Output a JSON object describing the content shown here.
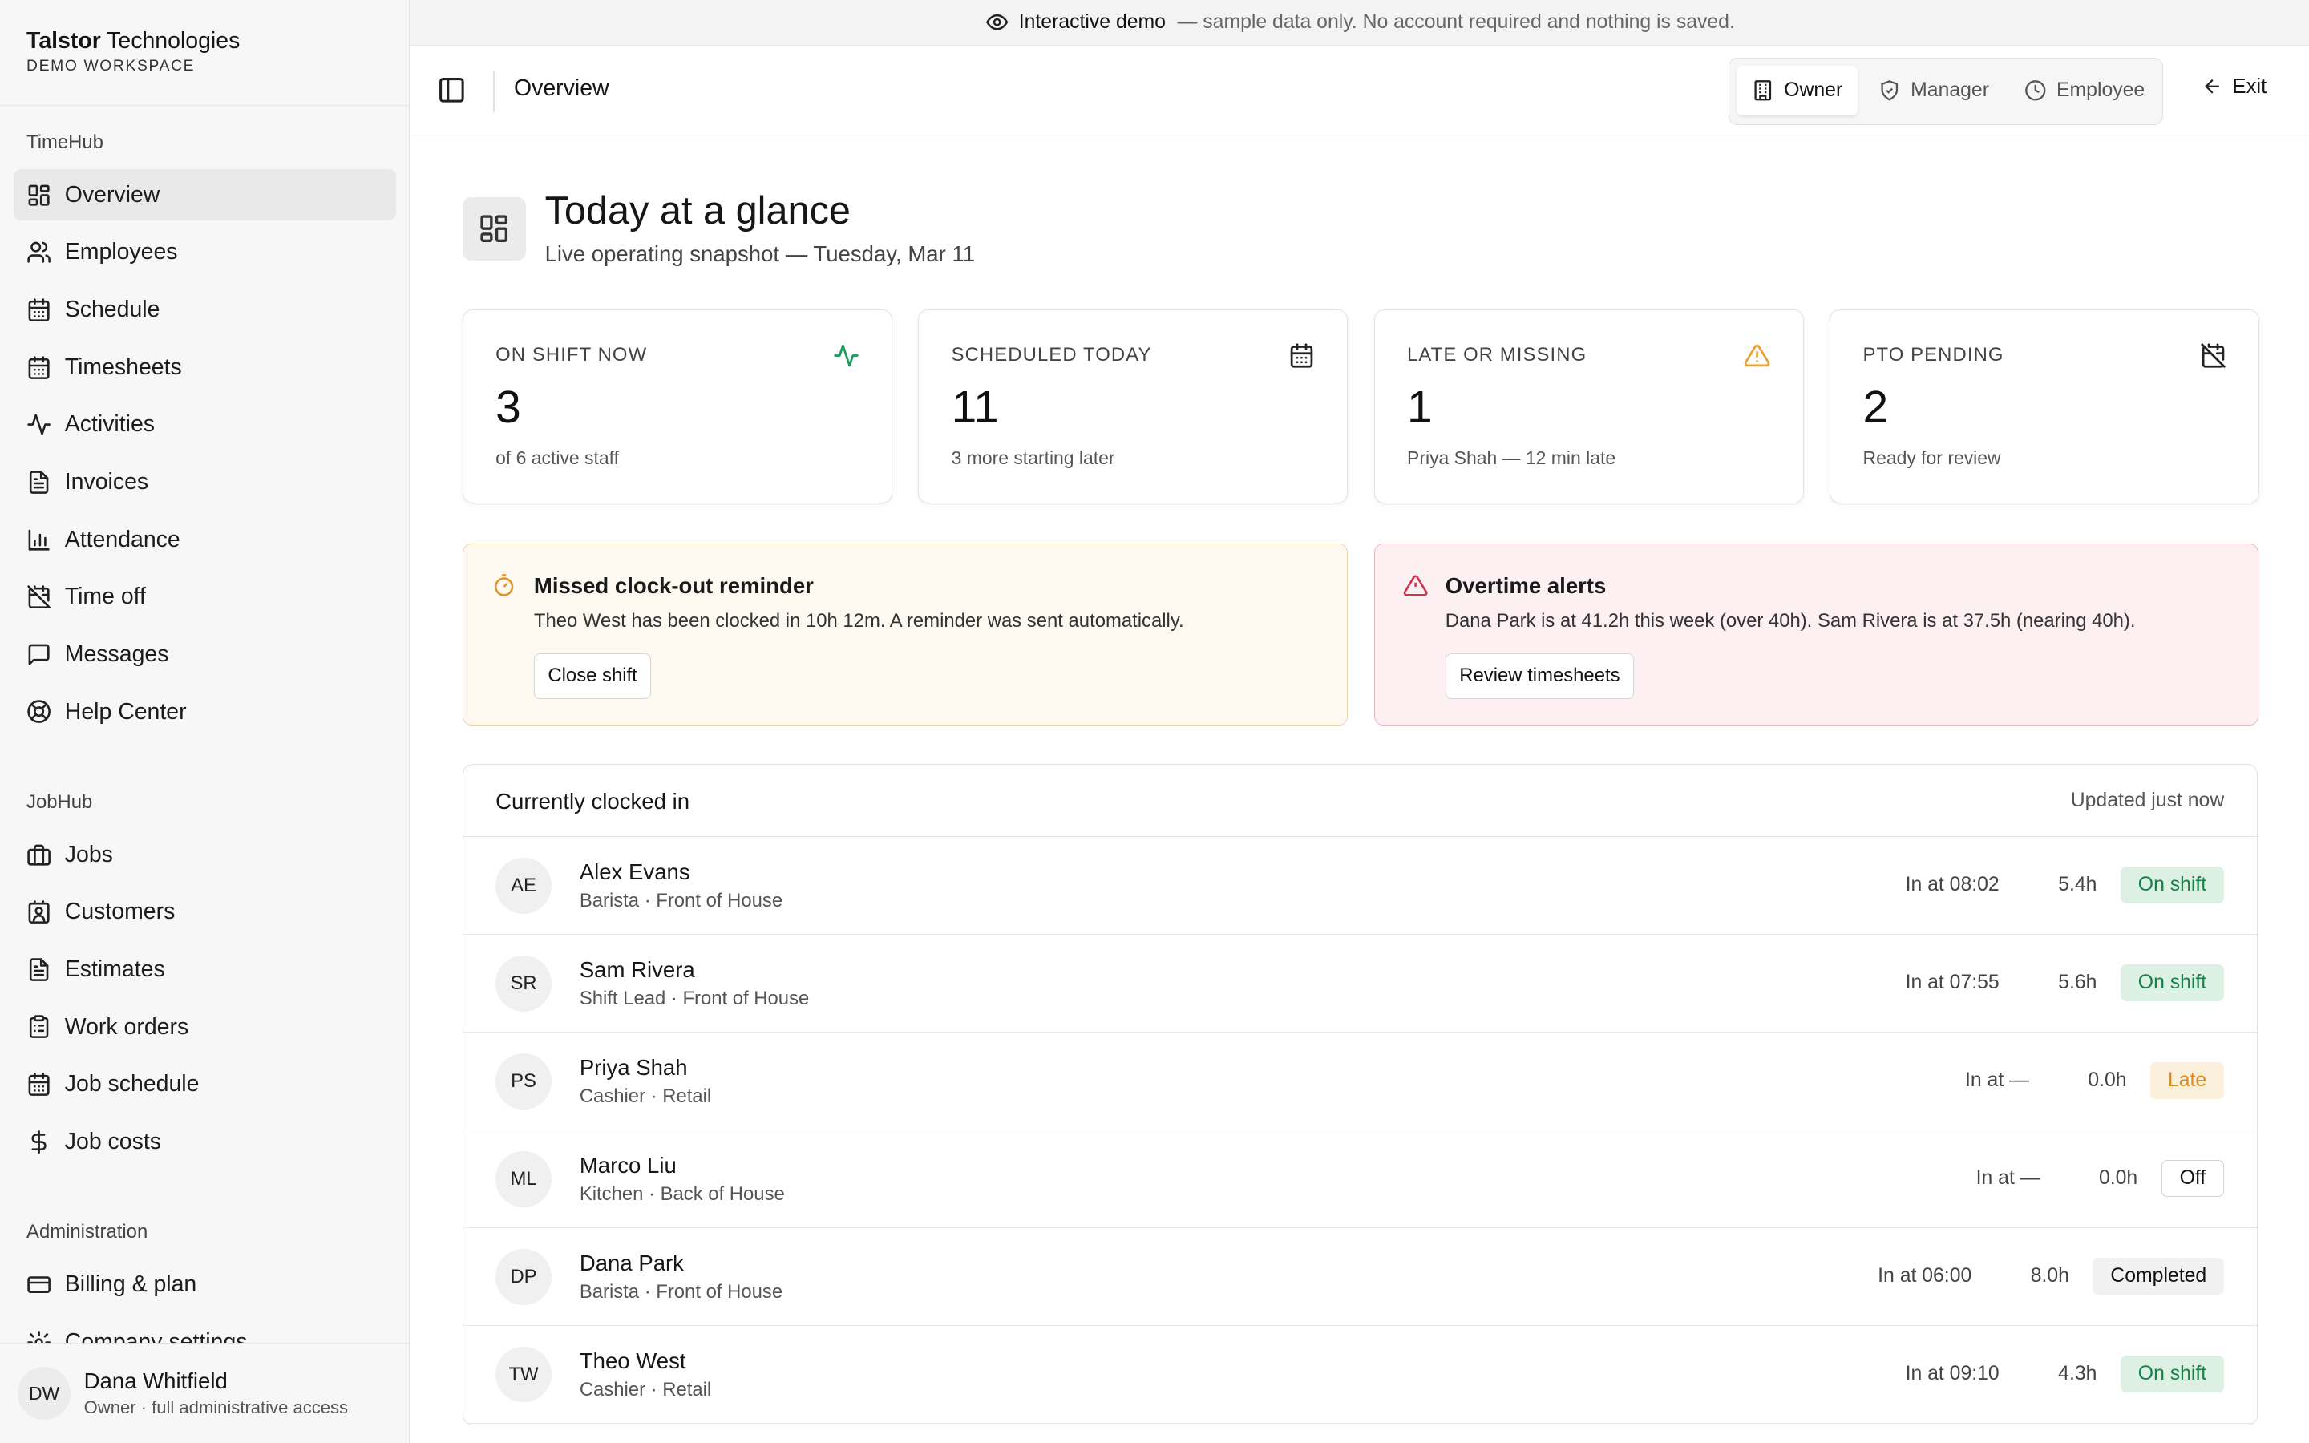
{
  "banner": {
    "label": "Interactive demo",
    "text": "— sample data only. No account required and nothing is saved."
  },
  "brand": {
    "name_bold": "Talstor",
    "name_rest": " Technologies",
    "sub": "DEMO WORKSPACE"
  },
  "sidebar": {
    "sections": [
      {
        "label": "TimeHub",
        "items": [
          {
            "label": "Overview",
            "icon": "grid-icon",
            "active": true
          },
          {
            "label": "Employees",
            "icon": "users-icon"
          },
          {
            "label": "Schedule",
            "icon": "calendar-icon"
          },
          {
            "label": "Timesheets",
            "icon": "calendar-icon"
          },
          {
            "label": "Activities",
            "icon": "activity-icon"
          },
          {
            "label": "Invoices",
            "icon": "file-icon"
          },
          {
            "label": "Attendance",
            "icon": "bar-chart-icon"
          },
          {
            "label": "Time off",
            "icon": "calendar-off-icon"
          },
          {
            "label": "Messages",
            "icon": "message-icon"
          },
          {
            "label": "Help Center",
            "icon": "life-buoy-icon"
          }
        ]
      },
      {
        "label": "JobHub",
        "items": [
          {
            "label": "Jobs",
            "icon": "briefcase-icon"
          },
          {
            "label": "Customers",
            "icon": "contact-icon"
          },
          {
            "label": "Estimates",
            "icon": "file-icon"
          },
          {
            "label": "Work orders",
            "icon": "clipboard-icon"
          },
          {
            "label": "Job schedule",
            "icon": "calendar-icon"
          },
          {
            "label": "Job costs",
            "icon": "dollar-icon"
          }
        ]
      },
      {
        "label": "Administration",
        "items": [
          {
            "label": "Billing & plan",
            "icon": "credit-card-icon"
          },
          {
            "label": "Company settings",
            "icon": "settings-icon"
          }
        ]
      }
    ]
  },
  "user": {
    "initials": "DW",
    "name": "Dana Whitfield",
    "role": "Owner · full administrative access"
  },
  "topbar": {
    "title": "Overview",
    "roles": [
      "Owner",
      "Manager",
      "Employee"
    ],
    "active_role": "Owner",
    "exit": "Exit"
  },
  "header": {
    "title": "Today at a glance",
    "subtitle": "Live operating snapshot — Tuesday, Mar 11"
  },
  "stats": [
    {
      "label": "ON SHIFT NOW",
      "value": "3",
      "sub": "of 6 active staff",
      "icon": "activity-icon",
      "color": "#1a9a5c"
    },
    {
      "label": "SCHEDULED TODAY",
      "value": "11",
      "sub": "3 more starting later",
      "icon": "calendar-icon",
      "color": "#222222"
    },
    {
      "label": "LATE OR MISSING",
      "value": "1",
      "sub": "Priya Shah — 12 min late",
      "icon": "warning-icon",
      "color": "#e6a23c"
    },
    {
      "label": "PTO PENDING",
      "value": "2",
      "sub": "Ready for review",
      "icon": "calendar-off-icon",
      "color": "#222222"
    }
  ],
  "alerts": [
    {
      "title": "Missed clock-out reminder",
      "desc": "Theo West has been clocked in 10h 12m. A reminder was sent automatically.",
      "button": "Close shift",
      "color": "#e0962c"
    },
    {
      "title": "Overtime alerts",
      "desc": "Dana Park is at 41.2h this week (over 40h). Sam Rivera is at 37.5h (nearing 40h).",
      "button": "Review timesheets",
      "color": "#d0334d"
    }
  ],
  "table": {
    "title": "Currently clocked in",
    "updated": "Updated just now",
    "rows": [
      {
        "initials": "AE",
        "name": "Alex Evans",
        "role": "Barista · Front of House",
        "in": "In at 08:02",
        "hours": "5.4h",
        "status": "On shift",
        "kind": "on"
      },
      {
        "initials": "SR",
        "name": "Sam Rivera",
        "role": "Shift Lead · Front of House",
        "in": "In at 07:55",
        "hours": "5.6h",
        "status": "On shift",
        "kind": "on"
      },
      {
        "initials": "PS",
        "name": "Priya Shah",
        "role": "Cashier · Retail",
        "in": "In at —",
        "hours": "0.0h",
        "status": "Late",
        "kind": "late"
      },
      {
        "initials": "ML",
        "name": "Marco Liu",
        "role": "Kitchen · Back of House",
        "in": "In at —",
        "hours": "0.0h",
        "status": "Off",
        "kind": "off"
      },
      {
        "initials": "DP",
        "name": "Dana Park",
        "role": "Barista · Front of House",
        "in": "In at 06:00",
        "hours": "8.0h",
        "status": "Completed",
        "kind": "done"
      },
      {
        "initials": "TW",
        "name": "Theo West",
        "role": "Cashier · Retail",
        "in": "In at 09:10",
        "hours": "4.3h",
        "status": "On shift",
        "kind": "on"
      }
    ]
  }
}
